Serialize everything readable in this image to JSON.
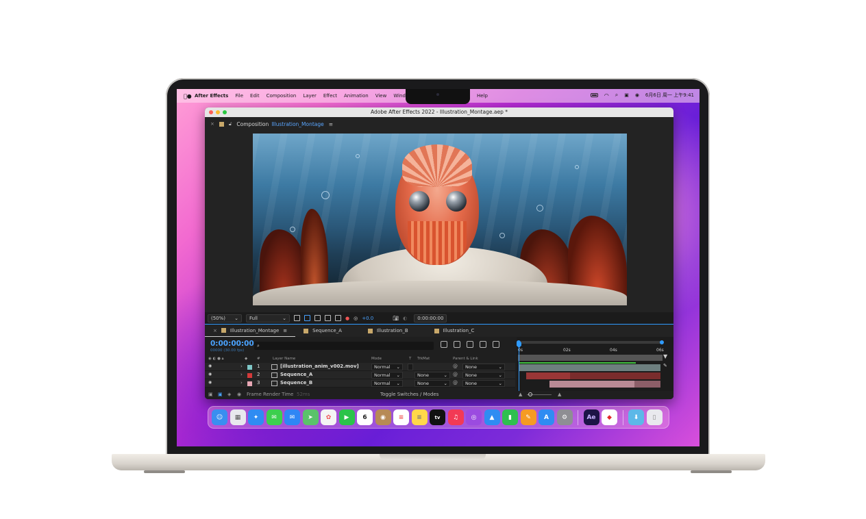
{
  "menubar": {
    "app_name": "After Effects",
    "items": [
      "File",
      "Edit",
      "Composition",
      "Layer",
      "Effect",
      "Animation",
      "View",
      "Window"
    ],
    "help": "Help",
    "clock": "6月6日 周一 上午9:41"
  },
  "window": {
    "title": "Adobe After Effects 2022 - Illustration_Montage.aep *"
  },
  "composition_panel": {
    "label": "Composition",
    "name": "Illustration_Montage"
  },
  "viewer_bar": {
    "zoom": "(50%)",
    "resolution": "Full",
    "exposure": "+0.0",
    "timecode": "0:00:00:00"
  },
  "timeline": {
    "tabs": [
      "Illustration_Montage",
      "Sequence_A",
      "Illustration_B",
      "Illustration_C"
    ],
    "tab_colors": [
      "#c8a86a",
      "#c8a86a",
      "#c8a86a",
      "#c8a86a"
    ],
    "timecode": "0:00:00:00",
    "fps": "00000 (30.00 fps)",
    "search_placeholder": "",
    "columns": {
      "hash": "#",
      "layer_name": "Layer Name",
      "mode": "Mode",
      "t": "T",
      "trkmat": "TrkMat",
      "parent": "Parent & Link"
    },
    "layers": [
      {
        "num": "1",
        "name": "[illustration_anim_v002.mov]",
        "mode": "Normal",
        "trkmat": "",
        "parent": "None",
        "color": "#7fc7c7"
      },
      {
        "num": "2",
        "name": "Sequence_A",
        "mode": "Normal",
        "trkmat": "None",
        "parent": "None",
        "color": "#d43a3a"
      },
      {
        "num": "3",
        "name": "Sequence_B",
        "mode": "Normal",
        "trkmat": "None",
        "parent": "None",
        "color": "#e8a7b5"
      }
    ],
    "ruler_ticks": [
      "0s",
      "02s",
      "04s",
      "06s"
    ],
    "footer_render_label": "Frame Render Time",
    "footer_render_value": "52ms",
    "footer_toggle": "Toggle Switches / Modes"
  },
  "dock": {
    "apps": [
      {
        "icon": "finder-icon",
        "color": "#3a8ef0",
        "glyph": "☺"
      },
      {
        "icon": "launchpad-icon",
        "color": "#e8e8ee",
        "glyph": "▦"
      },
      {
        "icon": "safari-icon",
        "color": "#2f8cf2",
        "glyph": "✦"
      },
      {
        "icon": "messages-icon",
        "color": "#3ccf4e",
        "glyph": "✉"
      },
      {
        "icon": "mail-icon",
        "color": "#2f86f5",
        "glyph": "✉"
      },
      {
        "icon": "maps-icon",
        "color": "#5bc36a",
        "glyph": "➤"
      },
      {
        "icon": "photos-icon",
        "color": "#f4f4f4",
        "glyph": "✿"
      },
      {
        "icon": "facetime-icon",
        "color": "#2bc34a",
        "glyph": "▶"
      },
      {
        "icon": "calendar-icon",
        "color": "#ffffff",
        "glyph": "6"
      },
      {
        "icon": "contacts-icon",
        "color": "#b78a56",
        "glyph": "◉"
      },
      {
        "icon": "reminders-icon",
        "color": "#ffffff",
        "glyph": "≡"
      },
      {
        "icon": "notes-icon",
        "color": "#ffd84a",
        "glyph": "≡"
      },
      {
        "icon": "apple-tv-icon",
        "color": "#111111",
        "glyph": "tv"
      },
      {
        "icon": "music-icon",
        "color": "#f23a55",
        "glyph": "♫"
      },
      {
        "icon": "podcasts-icon",
        "color": "#9b4be0",
        "glyph": "◎"
      },
      {
        "icon": "keynote-icon",
        "color": "#2f8cf2",
        "glyph": "▲"
      },
      {
        "icon": "numbers-icon",
        "color": "#2fbf4f",
        "glyph": "▮"
      },
      {
        "icon": "pages-icon",
        "color": "#f59b23",
        "glyph": "✎"
      },
      {
        "icon": "app-store-icon",
        "color": "#2f8cf2",
        "glyph": "A"
      },
      {
        "icon": "system-preferences-icon",
        "color": "#8e8e93",
        "glyph": "⚙"
      }
    ],
    "right_apps": [
      {
        "icon": "after-effects-icon",
        "color": "#1d1447",
        "glyph": "Ae",
        "fg": "#c7b3ff"
      },
      {
        "icon": "creative-cloud-icon",
        "color": "#ffffff",
        "glyph": "◆",
        "fg": "#e22b2b"
      }
    ],
    "extras": [
      {
        "icon": "downloads-folder-icon",
        "color": "#5cb8e8",
        "glyph": "⬇"
      },
      {
        "icon": "trash-icon",
        "color": "#e9e9ee",
        "glyph": "🗑"
      }
    ]
  }
}
